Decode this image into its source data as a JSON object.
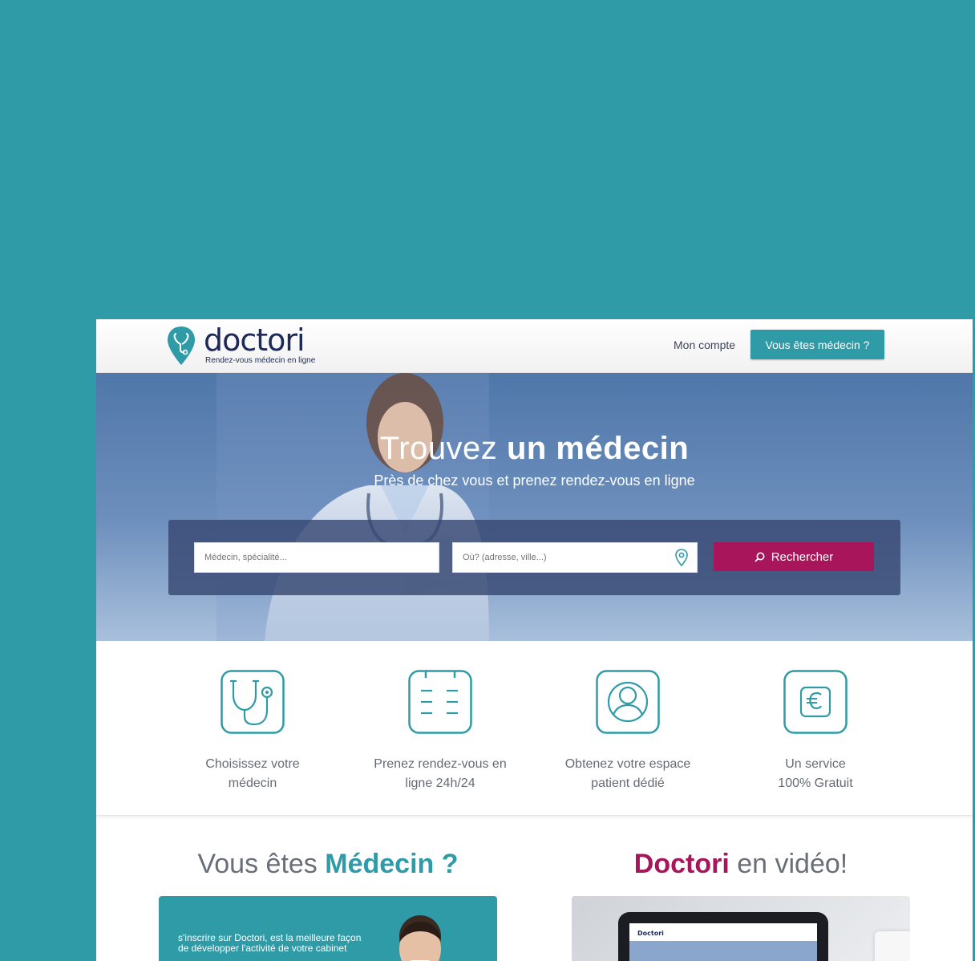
{
  "brand": {
    "name": "doctori",
    "tagline": "Rendez-vous médecin en ligne",
    "color_primary": "#2f9ba6",
    "color_accent": "#a8155b",
    "color_navy": "#1d2a57"
  },
  "nav": {
    "account_label": "Mon compte",
    "doctor_cta_label": "Vous êtes médecin ?"
  },
  "hero": {
    "title_light": "Trouvez",
    "title_bold": "un médecin",
    "subtitle": "Près de chez vous et prenez rendez-vous en ligne",
    "search": {
      "what_placeholder": "Médecin, spécialité...",
      "where_placeholder": "Où? (adresse, ville...)",
      "button_label": "Rechercher"
    }
  },
  "features": [
    {
      "icon": "stethoscope-icon",
      "line1": "Choisissez votre",
      "line2": "médecin"
    },
    {
      "icon": "calendar-icon",
      "line1": "Prenez rendez-vous en",
      "line2": "ligne 24h/24"
    },
    {
      "icon": "patient-icon",
      "line1": "Obtenez votre espace",
      "line2": "patient dédié"
    },
    {
      "icon": "euro-icon",
      "line1": "Un service",
      "line2": "100% Gratuit"
    }
  ],
  "doctor_section": {
    "title_light": "Vous êtes",
    "title_bold": "Médecin ?",
    "card_text": "s'inscrire sur Doctori, est la meilleure façon de développer l'activité de votre cabinet"
  },
  "video_section": {
    "title_bold": "Doctori",
    "title_light": "en vidéo!",
    "mini_logo": "Doctori"
  }
}
